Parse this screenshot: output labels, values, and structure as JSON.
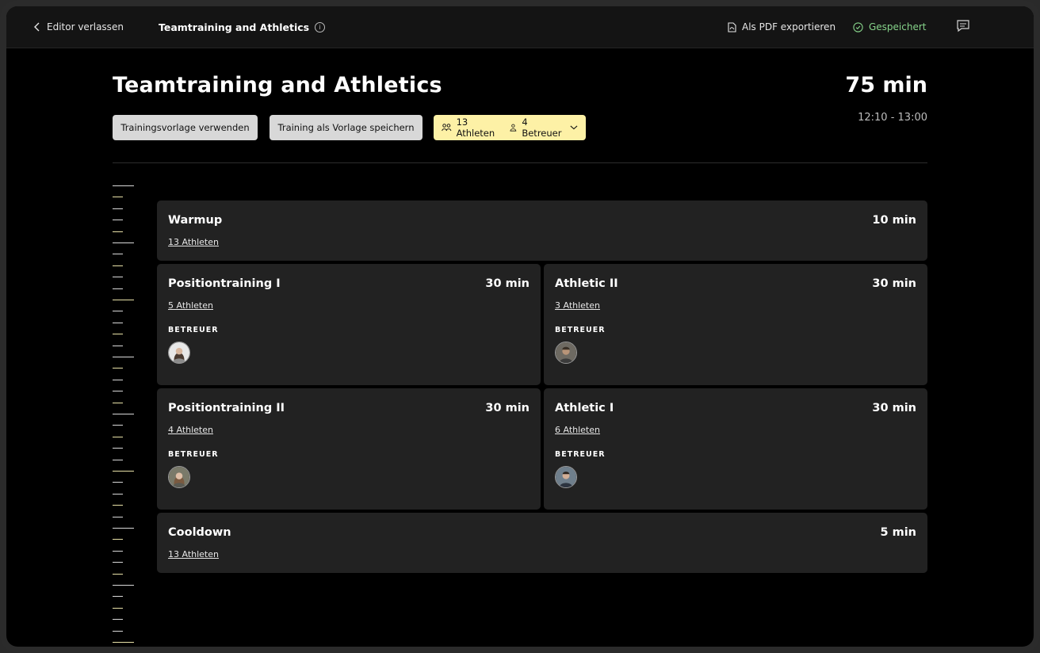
{
  "topbar": {
    "back_label": "Editor verlassen",
    "title": "Teamtraining and Athletics",
    "export_label": "Als PDF exportieren",
    "saved_label": "Gespeichert"
  },
  "header": {
    "title": "Teamtraining and Athletics",
    "total_duration": "75 min",
    "time_range": "12:10 - 13:00",
    "use_template_label": "Trainingsvorlage verwenden",
    "save_template_label": "Training als Vorlage speichern",
    "athletes_label": "13 Athleten",
    "coaches_label": "4 Betreuer"
  },
  "blocks": {
    "warmup": {
      "title": "Warmup",
      "duration": "10 min",
      "athletes": "13 Athleten"
    },
    "position1": {
      "title": "Positiontraining I",
      "duration": "30 min",
      "athletes": "5 Athleten",
      "coach_label": "BETREUER"
    },
    "athletic2": {
      "title": "Athletic II",
      "duration": "30 min",
      "athletes": "3 Athleten",
      "coach_label": "BETREUER"
    },
    "position2": {
      "title": "Positiontraining II",
      "duration": "30 min",
      "athletes": "4 Athleten",
      "coach_label": "BETREUER"
    },
    "athletic1": {
      "title": "Athletic I",
      "duration": "30 min",
      "athletes": "6 Athleten",
      "coach_label": "BETREUER"
    },
    "cooldown": {
      "title": "Cooldown",
      "duration": "5 min",
      "athletes": "13 Athleten"
    }
  },
  "colors": {
    "accent_yellow": "#fdf1a6",
    "saved_green": "#86d38a",
    "card_bg": "#222222"
  }
}
